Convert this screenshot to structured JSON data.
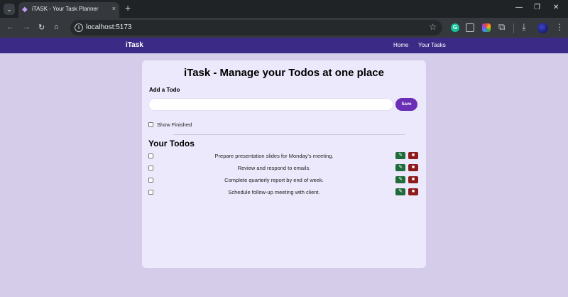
{
  "browser": {
    "tab_title": "iTASK - Your Task Planner",
    "url": "localhost:5173",
    "icons": {
      "tab_search": "chevron-down",
      "tab_close": "×",
      "new_tab": "+",
      "minimize": "—",
      "restore": "❐",
      "window_close": "✕",
      "back": "←",
      "forward": "→",
      "reload": "↻",
      "home": "⌂",
      "info": "i",
      "bookmark": "☆",
      "extensions": "⧉",
      "download": "⤓",
      "menu": "⋮"
    }
  },
  "navbar": {
    "brand": "iTask",
    "links": [
      "Home",
      "Your Tasks"
    ]
  },
  "card": {
    "title": "iTask - Manage your Todos at one place",
    "add_label": "Add a Todo",
    "input_value": "",
    "save_label": "Save",
    "show_finished_label": "Show Finished",
    "show_finished_checked": false,
    "todos_heading": "Your Todos",
    "todos": [
      {
        "text": "Prepare presentation slides for Monday's meeting.",
        "completed": false
      },
      {
        "text": "Review and respond to emails.",
        "completed": false
      },
      {
        "text": "Complete quarterly report by end of week.",
        "completed": false
      },
      {
        "text": "Schedule follow-up meeting with client.",
        "completed": false
      }
    ]
  },
  "colors": {
    "navbar_bg": "#3b2a86",
    "page_bg": "#d4cce8",
    "card_bg": "#ede9fc",
    "save_button": "#6b2fb5",
    "edit_button": "#1f6b3a",
    "delete_button": "#8f1a1a"
  }
}
